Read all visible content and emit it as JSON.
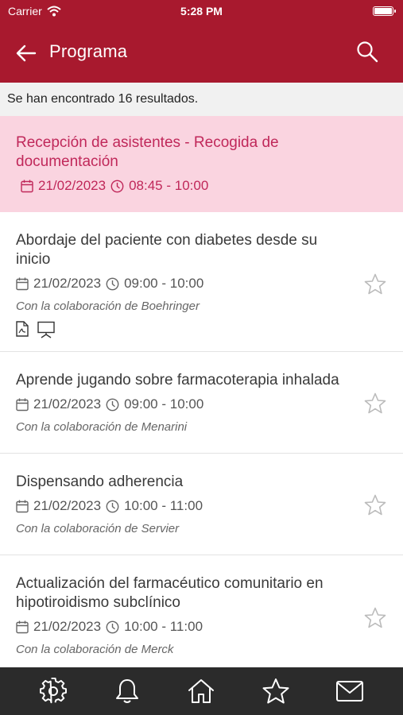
{
  "status": {
    "carrier": "Carrier",
    "time": "5:28 PM"
  },
  "header": {
    "title": "Programa"
  },
  "results": {
    "text": "Se han encontrado 16 resultados."
  },
  "items": [
    {
      "title": "Recepción de asistentes - Recogida de documentación",
      "date": "21/02/2023",
      "time": "08:45 - 10:00",
      "collab": "",
      "active": true
    },
    {
      "title": "Abordaje del paciente con diabetes desde su inicio",
      "date": "21/02/2023",
      "time": "09:00 - 10:00",
      "collab": "Con la colaboración de Boehringer",
      "docs": [
        "pdf-icon",
        "presentation-icon"
      ]
    },
    {
      "title": "Aprende jugando sobre farmacoterapia inhalada",
      "date": "21/02/2023",
      "time": "09:00 - 10:00",
      "collab": "Con la colaboración de Menarini"
    },
    {
      "title": "Dispensando adherencia",
      "date": "21/02/2023",
      "time": "10:00 - 11:00",
      "collab": "Con la colaboración de Servier"
    },
    {
      "title": "Actualización del farmacéutico comunitario en hipotiroidismo subclínico",
      "date": "21/02/2023",
      "time": "10:00 - 11:00",
      "collab": "Con la colaboración de Merck"
    }
  ],
  "tabs": [
    "gear-icon",
    "bell-icon",
    "home-icon",
    "star-icon",
    "mail-icon"
  ],
  "colors": {
    "brand": "#a8192e",
    "active_bg": "#fad4e0",
    "active_text": "#c0285a",
    "tab_bar": "#2b2b2b"
  }
}
